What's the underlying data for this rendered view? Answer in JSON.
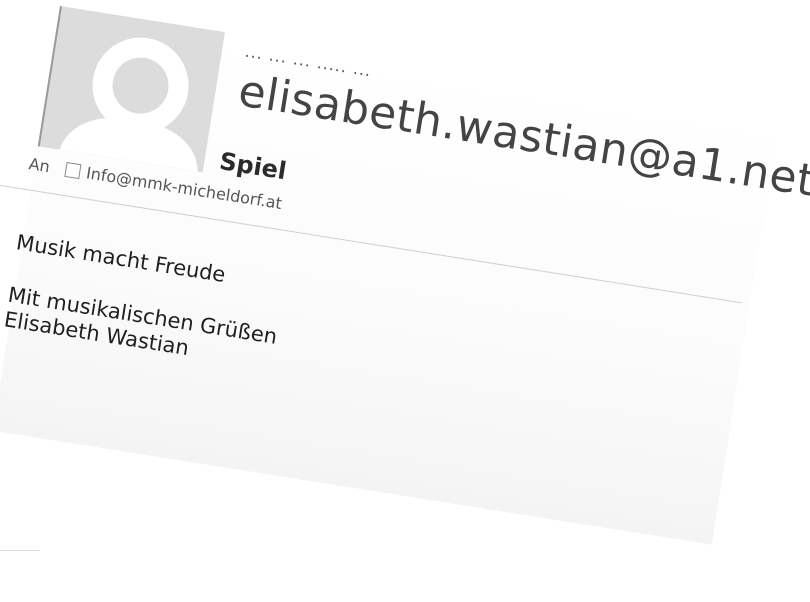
{
  "header": {
    "partial_line": "... ...  ... .....  ...",
    "sender_email": "elisabeth.wastian@a1.net",
    "subject": "Spiel"
  },
  "recipients": {
    "to_label": "An",
    "items": [
      {
        "address": "Info@mmk-micheldorf.at"
      }
    ]
  },
  "body": {
    "line1": "Musik macht Freude",
    "closing": "Mit musikalischen Grüßen",
    "signature_name": "Elisabeth Wastian"
  },
  "icons": {
    "avatar": "person-silhouette-icon",
    "recipient_checkbox": "checkbox-icon"
  },
  "colors": {
    "text": "#1f1f1f",
    "sender": "#444444",
    "avatar_bg": "#dcdcdc",
    "avatar_fg": "#ffffff"
  }
}
